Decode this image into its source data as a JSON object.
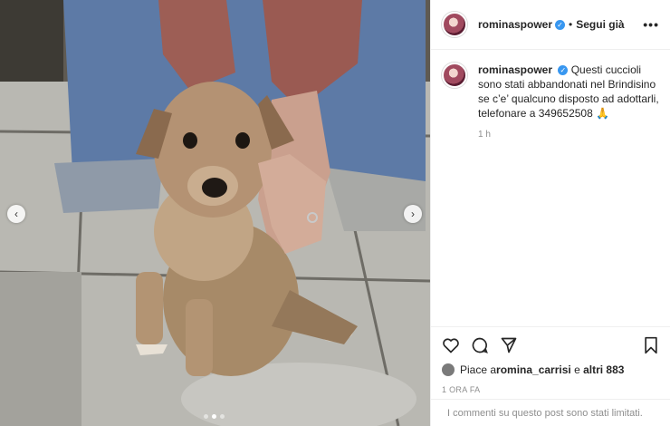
{
  "post": {
    "author": "rominaspower",
    "separator": "•",
    "follow_label": "Segui già",
    "more_label": "•••",
    "verified_mark": "✓",
    "caption": "Questi cuccioli sono stati abbandonati nel Brindisino se c’e’ qualcuno disposto ad adottarli, telefonare a 349652508 🙏",
    "caption_age": "1 h",
    "likes_prefix": "Piace a ",
    "likes_user": "romina_carrisi",
    "likes_connector": " e ",
    "likes_others": "altri 883",
    "timestamp": "1 ORA FA",
    "comments_notice": "I commenti su questo post sono stati limitati."
  },
  "media": {
    "prev_arrow": "‹",
    "next_arrow": "›",
    "carousel_slides": 3,
    "carousel_active": 2
  },
  "colors": {
    "verified": "#3897f0",
    "text": "#262626",
    "muted": "#8e8e8e"
  }
}
